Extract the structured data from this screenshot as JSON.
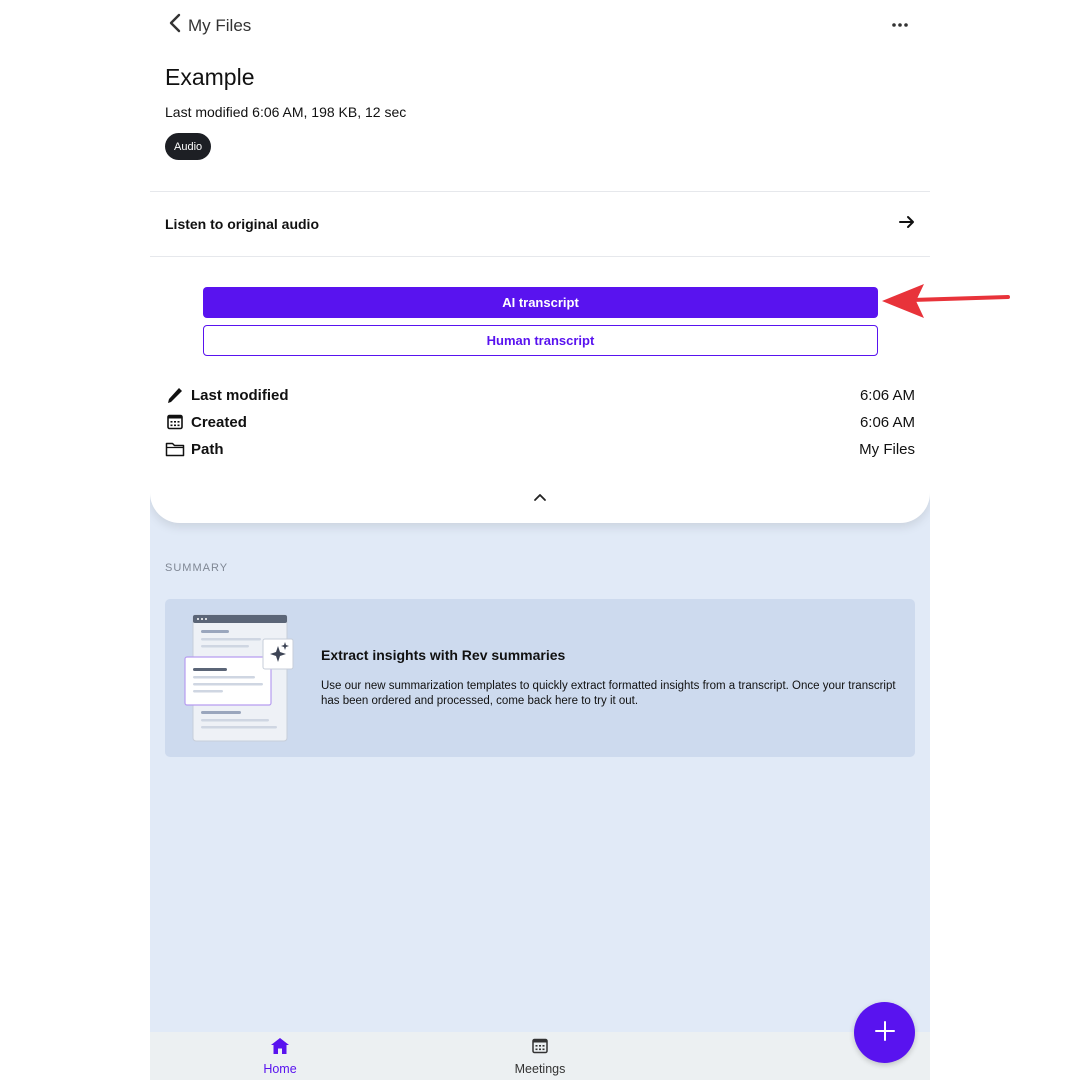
{
  "header": {
    "back_label": "My Files",
    "back_icon": "chevron-left-icon",
    "more_icon": "more-horizontal-icon"
  },
  "file": {
    "title": "Example",
    "meta": "Last modified 6:06 AM, 198 KB, 12 sec",
    "type_chip": "Audio"
  },
  "listen": {
    "label": "Listen to original audio",
    "icon": "arrow-right-icon"
  },
  "actions": {
    "ai_transcript": "AI transcript",
    "human_transcript": "Human transcript"
  },
  "details": [
    {
      "key": "Last modified",
      "value": "6:06 AM",
      "icon": "pencil-icon"
    },
    {
      "key": "Created",
      "value": "6:06 AM",
      "icon": "calendar-icon"
    },
    {
      "key": "Path",
      "value": "My Files",
      "icon": "folder-icon"
    }
  ],
  "summary": {
    "section_label": "SUMMARY",
    "title": "Extract insights with Rev summaries",
    "body": "Use our new summarization templates to quickly extract formatted insights from a transcript. Once your transcript has been ordered and processed, come back here to try it out."
  },
  "nav": {
    "items": [
      {
        "label": "Home",
        "icon": "home-icon",
        "active": true
      },
      {
        "label": "Meetings",
        "icon": "calendar-icon",
        "active": false
      }
    ]
  },
  "fab": {
    "icon": "plus-icon"
  },
  "colors": {
    "accent": "#5913ef",
    "background": "#e1eaf7",
    "summary_card": "#cddaee",
    "chip": "#1d1f24",
    "annotation": "#e8333a"
  }
}
